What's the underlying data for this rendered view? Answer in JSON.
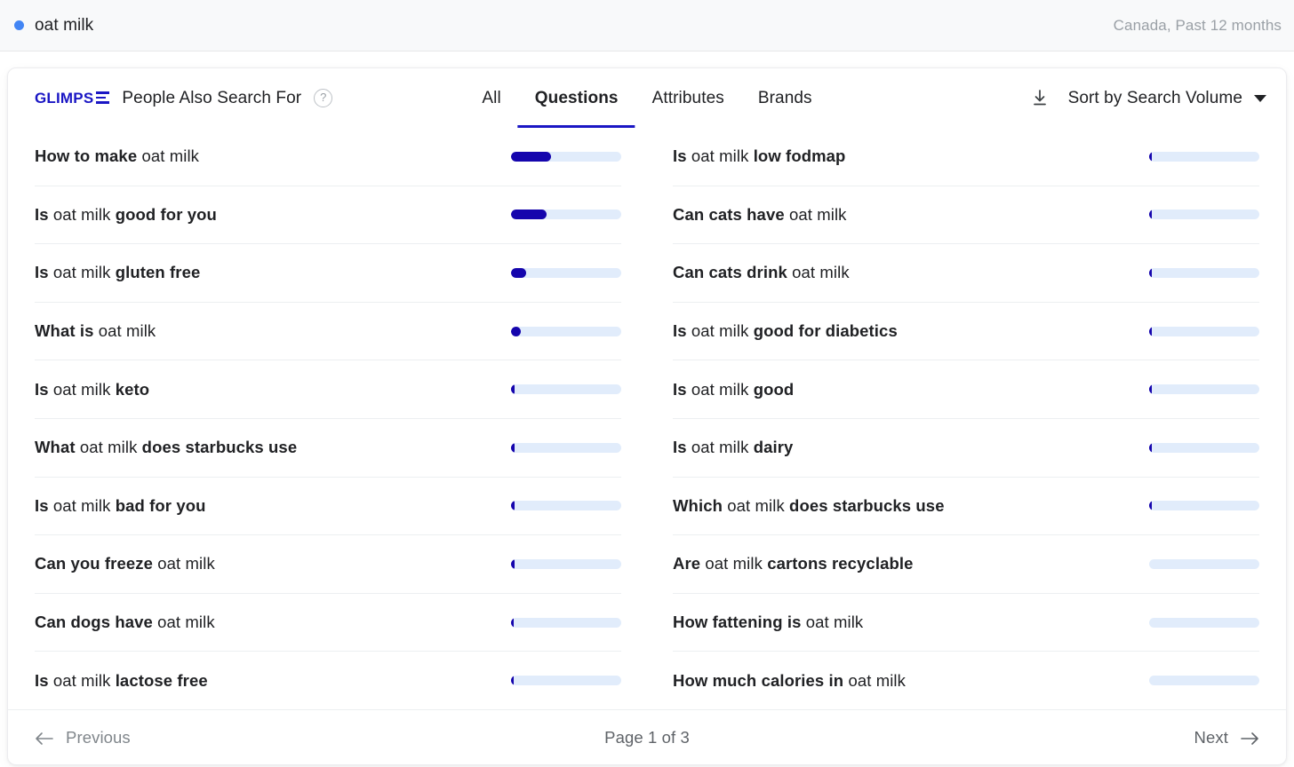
{
  "topbar": {
    "seed_term": "oat milk",
    "dot_color": "#4285f4",
    "scope": "Canada, Past 12 months"
  },
  "card": {
    "brand": "GLIMPS",
    "title": "People Also Search For",
    "help_icon": "question-mark-circle-icon",
    "download_icon": "download-icon",
    "sort_label": "Sort by Search Volume",
    "sort_caret_icon": "chevron-down-icon",
    "accent_color": "#1a16c4",
    "bar_fill_color": "#1505ad",
    "bar_track_color": "#e1ecfb",
    "tabs": [
      {
        "label": "All",
        "active": false
      },
      {
        "label": "Questions",
        "active": true
      },
      {
        "label": "Attributes",
        "active": false
      },
      {
        "label": "Brands",
        "active": false
      }
    ]
  },
  "results": {
    "left_column": [
      {
        "prefix": "How to make",
        "seed": "oat milk",
        "suffix": "",
        "bar_percent": 36
      },
      {
        "prefix": "Is",
        "seed": "oat milk",
        "suffix": "good for you",
        "bar_percent": 32
      },
      {
        "prefix": "Is",
        "seed": "oat milk",
        "suffix": "gluten free",
        "bar_percent": 14
      },
      {
        "prefix": "What is",
        "seed": "oat milk",
        "suffix": "",
        "bar_percent": 9
      },
      {
        "prefix": "Is",
        "seed": "oat milk",
        "suffix": "keto",
        "bar_percent": 3.5
      },
      {
        "prefix": "What",
        "seed": "oat milk",
        "suffix": "does starbucks use",
        "bar_percent": 3.2
      },
      {
        "prefix": "Is",
        "seed": "oat milk",
        "suffix": "bad for you",
        "bar_percent": 3
      },
      {
        "prefix": "Can you freeze",
        "seed": "oat milk",
        "suffix": "",
        "bar_percent": 3
      },
      {
        "prefix": "Can dogs have",
        "seed": "oat milk",
        "suffix": "",
        "bar_percent": 2.8
      },
      {
        "prefix": "Is",
        "seed": "oat milk",
        "suffix": "lactose free",
        "bar_percent": 2.8
      }
    ],
    "right_column": [
      {
        "prefix": "Is",
        "seed": "oat milk",
        "suffix": "low fodmap",
        "bar_percent": 2.5
      },
      {
        "prefix": "Can cats have",
        "seed": "oat milk",
        "suffix": "",
        "bar_percent": 2.5
      },
      {
        "prefix": "Can cats drink",
        "seed": "oat milk",
        "suffix": "",
        "bar_percent": 2.4
      },
      {
        "prefix": "Is",
        "seed": "oat milk",
        "suffix": "good for diabetics",
        "bar_percent": 2.4
      },
      {
        "prefix": "Is",
        "seed": "oat milk",
        "suffix": "good",
        "bar_percent": 2.2
      },
      {
        "prefix": "Is",
        "seed": "oat milk",
        "suffix": "dairy",
        "bar_percent": 2.2
      },
      {
        "prefix": "Which",
        "seed": "oat milk",
        "suffix": "does starbucks use",
        "bar_percent": 2
      },
      {
        "prefix": "Are",
        "seed": "oat milk",
        "suffix": "cartons recyclable",
        "bar_percent": 0
      },
      {
        "prefix": "How fattening is",
        "seed": "oat milk",
        "suffix": "",
        "bar_percent": 0
      },
      {
        "prefix": "How much calories in",
        "seed": "oat milk",
        "suffix": "",
        "bar_percent": 0
      }
    ]
  },
  "footer": {
    "previous_label": "Previous",
    "previous_icon": "arrow-left-icon",
    "previous_enabled": false,
    "page_indicator": "Page 1 of 3",
    "next_label": "Next",
    "next_icon": "arrow-right-icon",
    "next_enabled": true
  },
  "chart_data": {
    "type": "bar",
    "title": "People Also Search For — Questions (relative search volume)",
    "xlabel": "",
    "ylabel": "",
    "categories": [
      "How to make oat milk",
      "Is oat milk good for you",
      "Is oat milk gluten free",
      "What is oat milk",
      "Is oat milk keto",
      "What oat milk does starbucks use",
      "Is oat milk bad for you",
      "Can you freeze oat milk",
      "Can dogs have oat milk",
      "Is oat milk lactose free",
      "Is oat milk low fodmap",
      "Can cats have oat milk",
      "Can cats drink oat milk",
      "Is oat milk good for diabetics",
      "Is oat milk good",
      "Is oat milk dairy",
      "Which oat milk does starbucks use",
      "Are oat milk cartons recyclable",
      "How fattening is oat milk",
      "How much calories in oat milk"
    ],
    "values": [
      36,
      32,
      14,
      9,
      3.5,
      3.2,
      3,
      3,
      2.8,
      2.8,
      2.5,
      2.5,
      2.4,
      2.4,
      2.2,
      2.2,
      2,
      0,
      0,
      0
    ],
    "ylim": [
      0,
      100
    ],
    "grid": false,
    "legend": "none"
  }
}
